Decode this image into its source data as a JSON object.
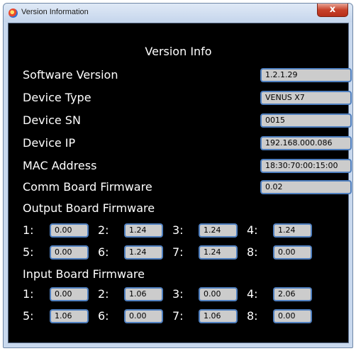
{
  "window": {
    "title": "Version Information",
    "close_label": "x"
  },
  "header": "Version Info",
  "info": [
    {
      "label": "Software Version",
      "value": "1.2.1.29"
    },
    {
      "label": "Device Type",
      "value": "VENUS X7"
    },
    {
      "label": "Device SN",
      "value": "0015"
    },
    {
      "label": "Device IP",
      "value": "192.168.000.086"
    },
    {
      "label": "MAC Address",
      "value": "18:30:70:00:15:00"
    },
    {
      "label": "Comm Board Firmware",
      "value": "0.02"
    }
  ],
  "output_board": {
    "title": "Output Board Firmware",
    "slots": [
      {
        "num": "1:",
        "value": "0.00"
      },
      {
        "num": "2:",
        "value": "1.24"
      },
      {
        "num": "3:",
        "value": "1.24"
      },
      {
        "num": "4:",
        "value": "1.24"
      },
      {
        "num": "5:",
        "value": "0.00"
      },
      {
        "num": "6:",
        "value": "1.24"
      },
      {
        "num": "7:",
        "value": "1.24"
      },
      {
        "num": "8:",
        "value": "0.00"
      }
    ]
  },
  "input_board": {
    "title": "Input Board Firmware",
    "slots": [
      {
        "num": "1:",
        "value": "0.00"
      },
      {
        "num": "2:",
        "value": "1.06"
      },
      {
        "num": "3:",
        "value": "0.00"
      },
      {
        "num": "4:",
        "value": "2.06"
      },
      {
        "num": "5:",
        "value": "1.06"
      },
      {
        "num": "6:",
        "value": "0.00"
      },
      {
        "num": "7:",
        "value": "1.06"
      },
      {
        "num": "8:",
        "value": "0.00"
      }
    ]
  }
}
